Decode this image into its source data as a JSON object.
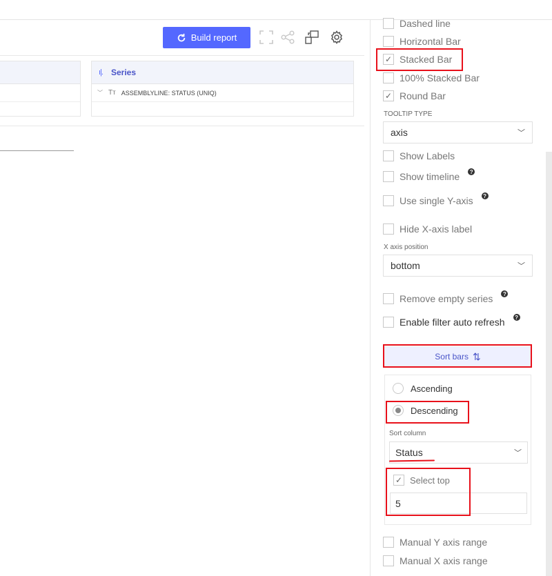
{
  "toolbar": {
    "build_label": "Build report",
    "icons": [
      "refresh-icon",
      "fullscreen-icon",
      "share-icon",
      "copy-icon",
      "settings-icon"
    ]
  },
  "series_box": {
    "title": "Series",
    "field_label": "ASSEMBLYLINE: STATUS (UNIQ)"
  },
  "options": {
    "dashed_line": {
      "label": "Dashed line",
      "checked": false
    },
    "horizontal_bar": {
      "label": "Horizontal Bar",
      "checked": false
    },
    "stacked_bar": {
      "label": "Stacked Bar",
      "checked": true
    },
    "stacked_100": {
      "label": "100% Stacked Bar",
      "checked": false
    },
    "round_bar": {
      "label": "Round Bar",
      "checked": true
    },
    "tooltip_type_label": "TOOLTIP TYPE",
    "tooltip_type_value": "axis",
    "show_labels": {
      "label": "Show Labels",
      "checked": false
    },
    "show_timeline": {
      "label": "Show timeline",
      "checked": false
    },
    "single_y_axis": {
      "label": "Use single Y-axis",
      "checked": false
    },
    "hide_x_label": {
      "label": "Hide X-axis label",
      "checked": false
    },
    "x_axis_position_label": "X axis position",
    "x_axis_position_value": "bottom",
    "remove_empty_series": {
      "label": "Remove empty series",
      "checked": false
    },
    "filter_auto_refresh": {
      "label": "Enable filter auto refresh",
      "checked": false
    },
    "manual_y_range": {
      "label": "Manual Y axis range",
      "checked": false
    },
    "manual_x_range": {
      "label": "Manual X axis range",
      "checked": false
    },
    "help_glyph": "?"
  },
  "sort": {
    "button_label": "Sort bars",
    "ascending_label": "Ascending",
    "descending_label": "Descending",
    "selected": "descending",
    "sort_column_label": "Sort column",
    "sort_column_value": "Status",
    "select_top_label": "Select top",
    "select_top_checked": true,
    "top_value": "5"
  },
  "accent_color": "#5468ff",
  "highlight_color": "#e8101a"
}
